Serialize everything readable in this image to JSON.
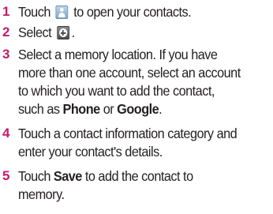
{
  "steps": [
    {
      "number": "1",
      "before": "Touch",
      "after": "to open your contacts."
    },
    {
      "number": "2",
      "before": "Select",
      "after": "."
    },
    {
      "number": "3",
      "lines": [
        "Select a memory location. If you have",
        "more than one account, select an account",
        "to which you want to add the contact,"
      ],
      "last_before": "such as",
      "bold1": "Phone",
      "mid": "or",
      "bold2": "Google",
      "last_after": "."
    },
    {
      "number": "4",
      "lines": [
        "Touch a contact information category and",
        "enter your contact's details."
      ]
    },
    {
      "number": "5",
      "before": "Touch",
      "bold": "Save",
      "after": "to add the contact to",
      "line2": "memory."
    }
  ],
  "icons": {
    "contacts": "contacts-app-icon",
    "add": "add-contact-icon"
  },
  "colors": {
    "step_number": "#c8186a",
    "text": "#231f20"
  }
}
